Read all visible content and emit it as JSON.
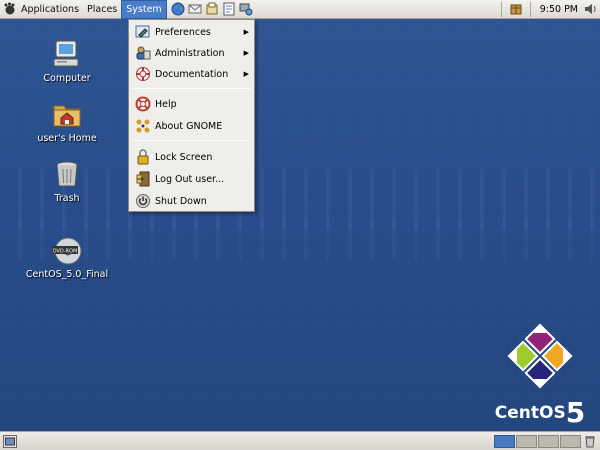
{
  "top_panel": {
    "menus": [
      {
        "label": "Applications"
      },
      {
        "label": "Places"
      },
      {
        "label": "System"
      }
    ],
    "launchers": [
      "web-browser-icon",
      "email-icon",
      "office-icon",
      "notes-icon",
      "network-icon"
    ],
    "clock": "9:50 PM"
  },
  "system_menu": {
    "items": [
      {
        "label": "Preferences",
        "icon": "preferences-icon",
        "submenu": true
      },
      {
        "label": "Administration",
        "icon": "administration-icon",
        "submenu": true
      },
      {
        "label": "Documentation",
        "icon": "documentation-icon",
        "submenu": true
      },
      {
        "label": "Help",
        "icon": "help-icon",
        "submenu": false
      },
      {
        "label": "About GNOME",
        "icon": "gnome-icon",
        "submenu": false
      },
      {
        "label": "Lock Screen",
        "icon": "lock-icon",
        "submenu": false
      },
      {
        "label": "Log Out user...",
        "icon": "logout-icon",
        "submenu": false
      },
      {
        "label": "Shut Down",
        "icon": "shutdown-icon",
        "submenu": false
      }
    ]
  },
  "desktop_icons": [
    {
      "label": "Computer",
      "icon": "computer-icon"
    },
    {
      "label": "user's Home",
      "icon": "home-folder-icon"
    },
    {
      "label": "Trash",
      "icon": "trash-icon"
    },
    {
      "label": "CentOS_5.0_Final",
      "icon": "dvd-icon"
    }
  ],
  "dvd_badge": "DVD-ROM",
  "brand": {
    "name": "CentOS",
    "version": "5"
  },
  "bottom_panel": {
    "workspaces": 4,
    "active_workspace": 1
  },
  "colors": {
    "desktop": "#2b4f8f",
    "menu_highlight": "#4a7cc7",
    "panel": "#e6e3dd"
  }
}
